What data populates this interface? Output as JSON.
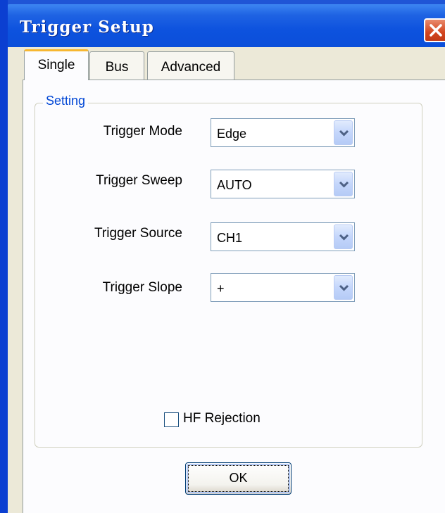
{
  "window": {
    "title": "Trigger Setup",
    "close_icon": "close-icon"
  },
  "tabs": [
    {
      "label": "Single",
      "active": true
    },
    {
      "label": "Bus",
      "active": false
    },
    {
      "label": "Advanced",
      "active": false
    }
  ],
  "setting_group": {
    "title": "Setting",
    "fields": [
      {
        "label": "Trigger Mode",
        "value": "Edge"
      },
      {
        "label": "Trigger Sweep",
        "value": "AUTO"
      },
      {
        "label": "Trigger Source",
        "value": "CH1"
      },
      {
        "label": "Trigger Slope",
        "value": "+"
      }
    ],
    "hf_rejection": {
      "label": "HF Rejection",
      "checked": false
    }
  },
  "buttons": {
    "ok_label": "OK"
  },
  "colors": {
    "titlebar": "#0b4fda",
    "group_title": "#0046d5",
    "dialog_bg": "#ece9d8",
    "active_tab_accent": "#f7b731"
  }
}
